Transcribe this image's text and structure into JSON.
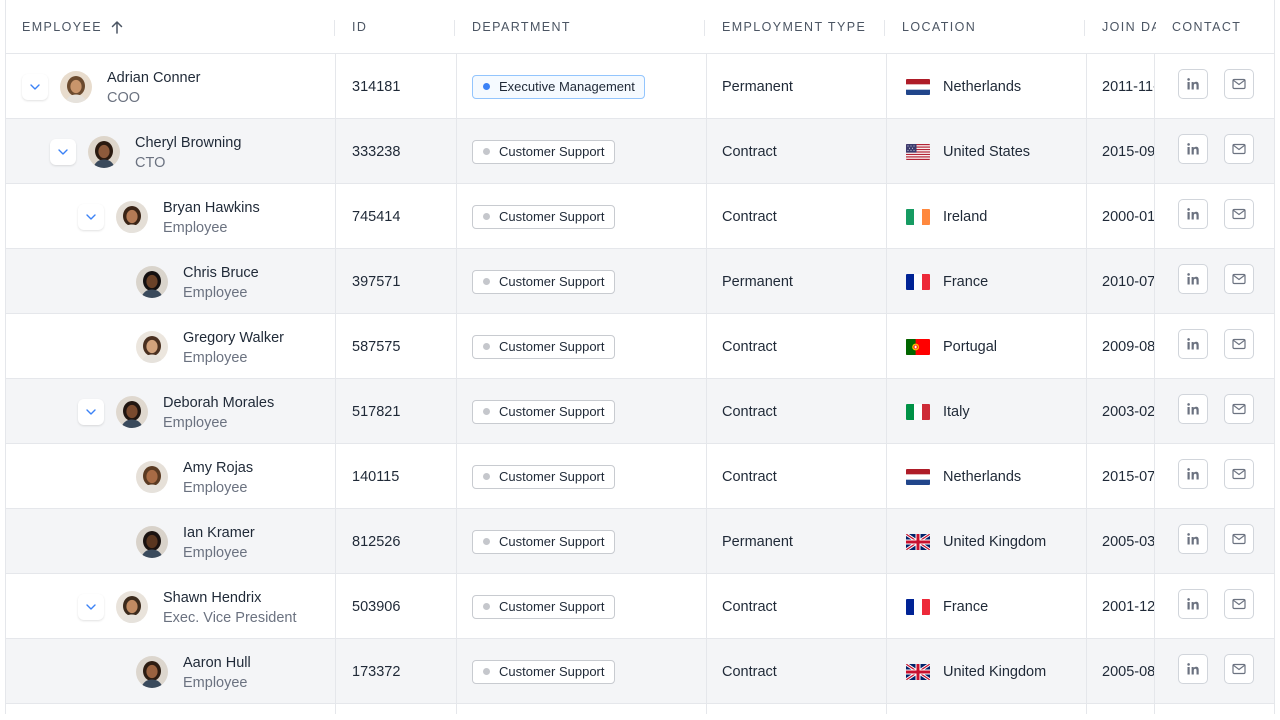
{
  "columns": {
    "employee": "Employee",
    "id": "ID",
    "department": "Department",
    "employment_type": "Employment Type",
    "location": "Location",
    "join_date": "Join Date",
    "contact": "Contact"
  },
  "sort": {
    "column": "employee",
    "direction": "ascending",
    "icon": "arrow-up-icon"
  },
  "colors": {
    "accent": "#3b82f6",
    "row_alt": "#f4f5f7",
    "border": "#e5e7eb"
  },
  "rows": [
    {
      "name": "Adrian Conner",
      "title": "COO",
      "level": 0,
      "expandable": true,
      "id": "314181",
      "department": "Executive Management",
      "department_style": "exec",
      "employment_type": "Permanent",
      "location": "Netherlands",
      "flag": "nl",
      "join_date": "2011-11-",
      "alt": false
    },
    {
      "name": "Cheryl Browning",
      "title": "CTO",
      "level": 1,
      "expandable": true,
      "id": "333238",
      "department": "Customer Support",
      "department_style": "default",
      "employment_type": "Contract",
      "location": "United States",
      "flag": "us",
      "join_date": "2015-09",
      "alt": true
    },
    {
      "name": "Bryan Hawkins",
      "title": "Employee",
      "level": 2,
      "expandable": true,
      "id": "745414",
      "department": "Customer Support",
      "department_style": "default",
      "employment_type": "Contract",
      "location": "Ireland",
      "flag": "ie",
      "join_date": "2000-01",
      "alt": false
    },
    {
      "name": "Chris Bruce",
      "title": "Employee",
      "level": 3,
      "expandable": false,
      "id": "397571",
      "department": "Customer Support",
      "department_style": "default",
      "employment_type": "Permanent",
      "location": "France",
      "flag": "fr",
      "join_date": "2010-07",
      "alt": true
    },
    {
      "name": "Gregory Walker",
      "title": "Employee",
      "level": 3,
      "expandable": false,
      "id": "587575",
      "department": "Customer Support",
      "department_style": "default",
      "employment_type": "Contract",
      "location": "Portugal",
      "flag": "pt",
      "join_date": "2009-08",
      "alt": false
    },
    {
      "name": "Deborah Morales",
      "title": "Employee",
      "level": 2,
      "expandable": true,
      "id": "517821",
      "department": "Customer Support",
      "department_style": "default",
      "employment_type": "Contract",
      "location": "Italy",
      "flag": "it",
      "join_date": "2003-02",
      "alt": true
    },
    {
      "name": "Amy Rojas",
      "title": "Employee",
      "level": 3,
      "expandable": false,
      "id": "140115",
      "department": "Customer Support",
      "department_style": "default",
      "employment_type": "Contract",
      "location": "Netherlands",
      "flag": "nl",
      "join_date": "2015-07",
      "alt": false
    },
    {
      "name": "Ian Kramer",
      "title": "Employee",
      "level": 3,
      "expandable": false,
      "id": "812526",
      "department": "Customer Support",
      "department_style": "default",
      "employment_type": "Permanent",
      "location": "United Kingdom",
      "flag": "gb",
      "join_date": "2005-03",
      "alt": true
    },
    {
      "name": "Shawn Hendrix",
      "title": "Exec. Vice President",
      "level": 2,
      "expandable": true,
      "id": "503906",
      "department": "Customer Support",
      "department_style": "default",
      "employment_type": "Contract",
      "location": "France",
      "flag": "fr",
      "join_date": "2001-12",
      "alt": false
    },
    {
      "name": "Aaron Hull",
      "title": "Employee",
      "level": 3,
      "expandable": false,
      "id": "173372",
      "department": "Customer Support",
      "department_style": "default",
      "employment_type": "Contract",
      "location": "United Kingdom",
      "flag": "gb",
      "join_date": "2005-08",
      "alt": true
    }
  ]
}
